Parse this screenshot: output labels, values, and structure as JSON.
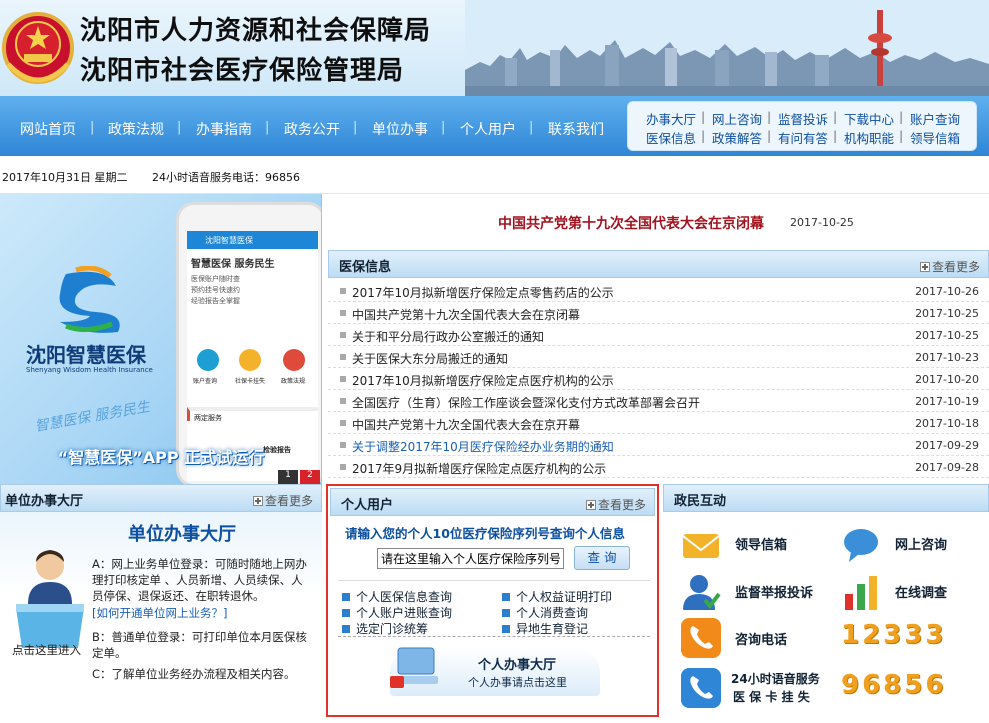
{
  "header": {
    "title_line1": "沈阳市人力资源和社会保障局",
    "title_line2": "沈阳市社会医疗保险管理局"
  },
  "nav": {
    "items": [
      "网站首页",
      "政策法规",
      "办事指南",
      "政务公开",
      "单位办事",
      "个人用户",
      "联系我们"
    ]
  },
  "quick_links": {
    "row1": [
      "办事大厅",
      "网上咨询",
      "监督投诉",
      "下载中心",
      "账户查询"
    ],
    "row2": [
      "医保信息",
      "政策解答",
      "有问有答",
      "机构职能",
      "领导信箱"
    ]
  },
  "date_bar": {
    "date": "2017年10月31日 星期二",
    "hotline": "24小时语音服务电话：96856"
  },
  "banner": {
    "app_name": "沈阳智慧医保",
    "app_en": "Shenyang Wisdom Health Insurance",
    "slogan": "“智慧医保”APP 正式试运行",
    "phone_header": "沈阳智慧医保",
    "phone_tagline": "智慧医保 服务民生",
    "phone_bullets": [
      "医保账户随时查",
      "预约挂号快速约",
      "经验报告全掌握"
    ],
    "phone_icons": [
      "账户查询",
      "社保卡挂失",
      "政策法规"
    ],
    "phone_section": "两定服务",
    "phone_item": "检验报告",
    "pages": [
      "1",
      "2"
    ],
    "watermark": "智慧医保 服务民生"
  },
  "headline": {
    "title": "中国共产党第十九次全国代表大会在京闭幕",
    "date": "2017-10-25"
  },
  "news": {
    "title": "医保信息",
    "more": "查看更多",
    "items": [
      {
        "title": "2017年10月拟新增医疗保险定点零售药店的公示",
        "date": "2017-10-26",
        "color": "#222"
      },
      {
        "title": "中国共产党第十九次全国代表大会在京闭幕",
        "date": "2017-10-25",
        "color": "#222"
      },
      {
        "title": "关于和平分局行政办公室搬迁的通知",
        "date": "2017-10-25",
        "color": "#222"
      },
      {
        "title": "关于医保大东分局搬迁的通知",
        "date": "2017-10-23",
        "color": "#222"
      },
      {
        "title": "2017年10月拟新增医疗保险定点医疗机构的公示",
        "date": "2017-10-20",
        "color": "#222"
      },
      {
        "title": "全国医疗（生育）保险工作座谈会暨深化支付方式改革部署会召开",
        "date": "2017-10-19",
        "color": "#222"
      },
      {
        "title": "中国共产党第十九次全国代表大会在京开幕",
        "date": "2017-10-18",
        "color": "#222"
      },
      {
        "title": "关于调整2017年10月医疗保险经办业务期的通知",
        "date": "2017-09-29",
        "color": "#1a5fb4"
      },
      {
        "title": "2017年9月拟新增医疗保险定点医疗机构的公示",
        "date": "2017-09-28",
        "color": "#222"
      }
    ]
  },
  "unit_hall": {
    "title": "单位办事大厅",
    "more": "查看更多",
    "big_title": "单位办事大厅",
    "para_a": "A：网上业务单位登录：可随时随地上网办理打印核定单 、人员新增、人员续保、人员停保、退保返还、在职转退休。",
    "para_a_link": "[如何开通单位网上业务？]",
    "para_b": "B：普通单位登录：可打印单位本月医保核定单。",
    "para_c": "C：了解单位业务经办流程及相关内容。",
    "enter": "点击这里进入"
  },
  "personal": {
    "title": "个人用户",
    "more": "查看更多",
    "prompt": "请输入您的个人10位医疗保险序列号查询个人信息",
    "input_value": "请在这里输入个人医疗保险序列号",
    "query_button": "查 询",
    "links": [
      "个人医保信息查询",
      "个人权益证明打印",
      "个人账户进账查询",
      "个人消费查询",
      "选定门诊统筹",
      "异地生育登记"
    ],
    "hall_title": "个人办事大厅",
    "hall_sub": "个人办事请点击这里"
  },
  "gov": {
    "title": "政民互动",
    "items": [
      "领导信箱",
      "网上咨询",
      "监督举报投诉",
      "在线调查",
      "咨询电话"
    ],
    "hotline_label": "24小时语音服务",
    "card_label": "医 保 卡 挂 失",
    "number1": "12333",
    "number2": "96856",
    "colors": {
      "mail": "#f2b32a",
      "consult": "#3a8fd8",
      "report": "#2e6fc0",
      "survey": "#3aa84a",
      "phone": "#f28a1a",
      "hotline": "#2f86d6"
    }
  }
}
